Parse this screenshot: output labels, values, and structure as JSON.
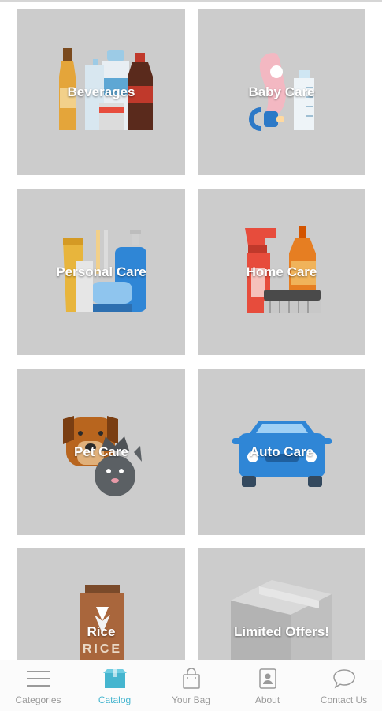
{
  "categories": [
    {
      "label": "Beverages"
    },
    {
      "label": "Baby Care"
    },
    {
      "label": "Personal Care"
    },
    {
      "label": "Home Care"
    },
    {
      "label": "Pet Care"
    },
    {
      "label": "Auto Care"
    },
    {
      "label": "Rice"
    },
    {
      "label": "Limited Offers!"
    }
  ],
  "rice_bag_text": "RICE",
  "bottom_nav": {
    "items": [
      {
        "label": "Categories",
        "icon": "menu-icon",
        "active": false
      },
      {
        "label": "Catalog",
        "icon": "box-icon",
        "active": true
      },
      {
        "label": "Your Bag",
        "icon": "bag-icon",
        "active": false
      },
      {
        "label": "About",
        "icon": "id-card-icon",
        "active": false
      },
      {
        "label": "Contact Us",
        "icon": "chat-bubble-icon",
        "active": false
      }
    ]
  },
  "colors": {
    "tile_background": "#cccccc",
    "active_nav": "#45b5cf",
    "inactive_nav": "#9a9a9a"
  }
}
